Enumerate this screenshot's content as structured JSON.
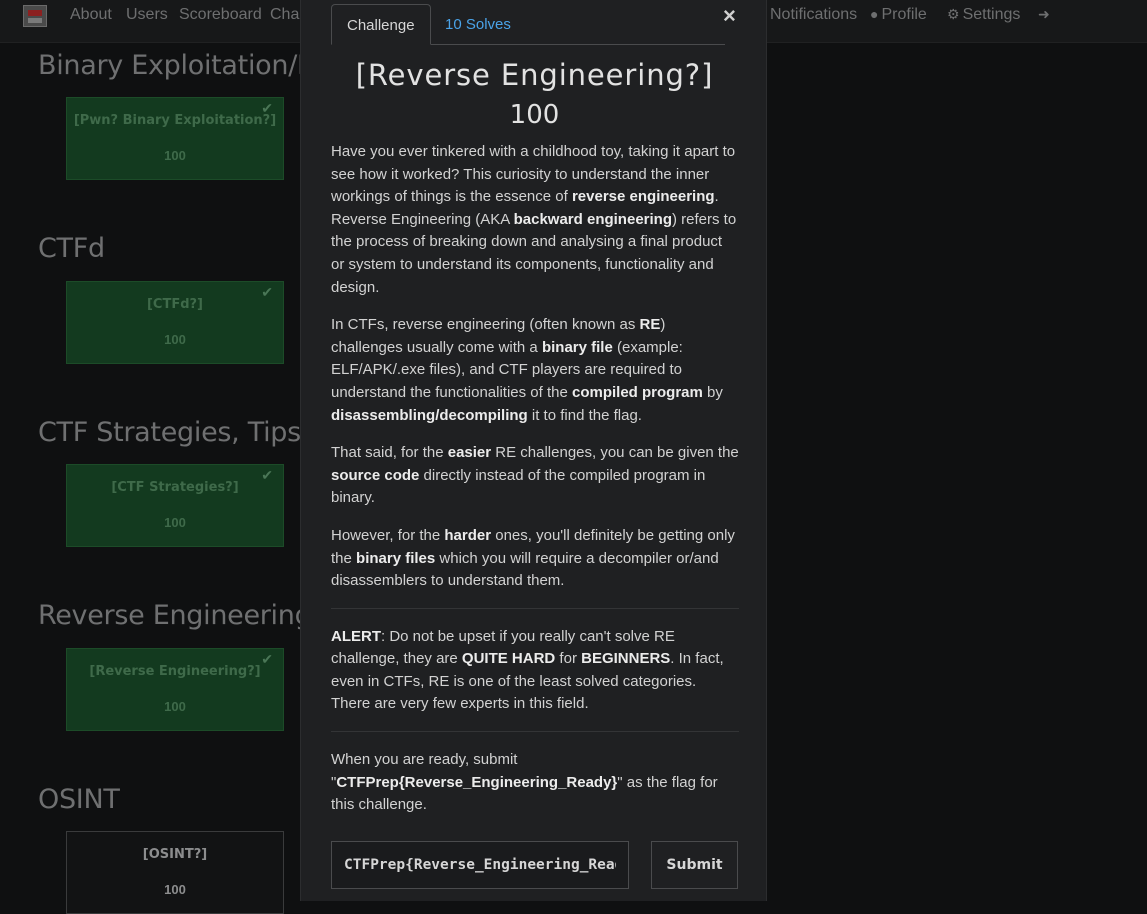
{
  "navbar": {
    "items": [
      {
        "label": "About"
      },
      {
        "label": "Users"
      },
      {
        "label": "Scoreboard"
      },
      {
        "label": "Cha"
      },
      {
        "label": "Notifications"
      },
      {
        "label": "Profile",
        "icon": "user-circle-icon"
      },
      {
        "label": "Settings",
        "icon": "gears-icon"
      },
      {
        "label": "",
        "icon": "logout-icon"
      }
    ]
  },
  "categories": [
    {
      "title": "Binary Exploitation/Pw",
      "challenge": {
        "name": "[Pwn? Binary Exploitation?]",
        "value": "100",
        "solved": true
      }
    },
    {
      "title": "CTFd",
      "challenge": {
        "name": "[CTFd?]",
        "value": "100",
        "solved": true
      }
    },
    {
      "title": "CTF Strategies, Tips and",
      "challenge": {
        "name": "[CTF Strategies?]",
        "value": "100",
        "solved": true
      }
    },
    {
      "title": "Reverse Engineering",
      "challenge": {
        "name": "[Reverse Engineering?]",
        "value": "100",
        "solved": true
      }
    },
    {
      "title": "OSINT",
      "challenge": {
        "name": "[OSINT?]",
        "value": "100",
        "solved": false
      }
    }
  ],
  "modal": {
    "tabs": [
      {
        "label": "Challenge"
      },
      {
        "label": "10 Solves"
      }
    ],
    "close": "×",
    "title": "[Reverse Engineering?]",
    "value": "100",
    "description": [
      [
        {
          "t": "Have you ever tinkered with a childhood toy, taking it apart to see how it worked? This curiosity to understand the inner workings of things is the essence of "
        },
        {
          "t": "reverse engineering",
          "b": true
        },
        {
          "t": ". Reverse Engineering (AKA "
        },
        {
          "t": "backward engineering",
          "b": true
        },
        {
          "t": ") refers to the process of breaking down and analysing a final product or system to understand its components, functionality and design."
        }
      ],
      [
        {
          "t": "In CTFs, reverse engineering (often known as "
        },
        {
          "t": "RE",
          "b": true
        },
        {
          "t": ") challenges usually come with a "
        },
        {
          "t": "binary file",
          "b": true
        },
        {
          "t": " (example: ELF/APK/.exe files), and CTF players are required to understand the functionalities of the "
        },
        {
          "t": "compiled program",
          "b": true
        },
        {
          "t": " by "
        },
        {
          "t": "disassembling/decompiling",
          "b": true
        },
        {
          "t": " it to find the flag."
        }
      ],
      [
        {
          "t": "That said, for the "
        },
        {
          "t": "easier",
          "b": true
        },
        {
          "t": " RE challenges, you can be given the "
        },
        {
          "t": "source code",
          "b": true
        },
        {
          "t": " directly instead of the compiled program in binary."
        }
      ],
      [
        {
          "t": "However, for the "
        },
        {
          "t": "harder",
          "b": true
        },
        {
          "t": " ones, you'll definitely be getting only the "
        },
        {
          "t": "binary files",
          "b": true
        },
        {
          "t": " which you will require a decompiler or/and disassemblers to understand them."
        }
      ],
      "hr",
      [
        {
          "t": "ALERT",
          "b": true
        },
        {
          "t": ": Do not be upset if you really can't solve RE challenge, they are "
        },
        {
          "t": "QUITE HARD",
          "b": true
        },
        {
          "t": " for "
        },
        {
          "t": "BEGINNERS",
          "b": true
        },
        {
          "t": ". In fact, even in CTFs, RE is one of the least solved categories. There are very few experts in this field."
        }
      ],
      "hr",
      [
        {
          "t": "When you are ready, submit \""
        },
        {
          "t": "CTFPrep{Reverse_Engineering_Ready}",
          "b": true
        },
        {
          "t": "\" as the flag for this challenge."
        }
      ]
    ],
    "flag_input_value": "CTFPrep{Reverse_Engineering_Ready}",
    "submit_label": "Submit"
  },
  "colors": {
    "solved_bg": "#133a1f",
    "link": "#4aa3e8",
    "modal_bg": "#1f2022",
    "page_bg": "#0f1011"
  }
}
